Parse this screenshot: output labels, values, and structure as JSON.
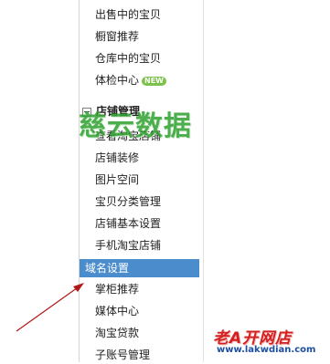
{
  "menu": {
    "top_items": [
      {
        "label": "出售中的宝贝"
      },
      {
        "label": "橱窗推荐"
      },
      {
        "label": "仓库中的宝贝"
      },
      {
        "label": "体检中心",
        "badge": "NEW"
      }
    ],
    "section": {
      "title": "店铺管理",
      "items": [
        {
          "label": "查看淘宝店铺"
        },
        {
          "label": "店铺装修"
        },
        {
          "label": "图片空间"
        },
        {
          "label": "宝贝分类管理"
        },
        {
          "label": "店铺基本设置"
        },
        {
          "label": "手机淘宝店铺"
        },
        {
          "label": "域名设置",
          "selected": true
        },
        {
          "label": "掌柜推荐"
        },
        {
          "label": "媒体中心"
        },
        {
          "label": "淘宝贷款"
        },
        {
          "label": "子账号管理"
        }
      ]
    }
  },
  "watermark": {
    "text": "慈云数据"
  },
  "site_logo": {
    "name": "老A开网店",
    "url": "www.lakwdian.com"
  },
  "colors": {
    "selected_background": "#4b8ccc",
    "watermark": "#2ea12e",
    "logo_red": "#d21f1f",
    "logo_blue": "#1d4fa1",
    "arrow": "#b01818"
  }
}
